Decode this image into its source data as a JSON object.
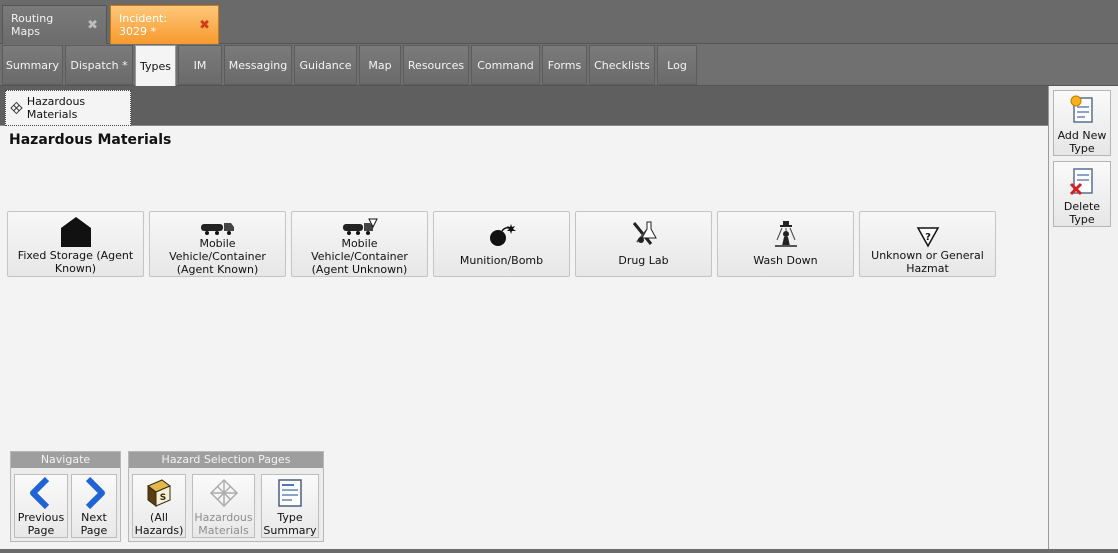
{
  "doc_tabs": [
    {
      "label": "Routing Maps",
      "close": "✖",
      "active": false
    },
    {
      "label": "Incident: 3029 *",
      "close": "✖",
      "active": true
    }
  ],
  "section_tabs": [
    "Summary",
    "Dispatch *",
    "Types",
    "IM",
    "Messaging",
    "Guidance",
    "Map",
    "Resources",
    "Command",
    "Forms",
    "Checklists",
    "Log"
  ],
  "active_section": "Types",
  "subtab": {
    "label": "Hazardous Materials",
    "icon": "hazmat-diamond-icon"
  },
  "page_title": "Hazardous Materials",
  "type_buttons": [
    {
      "label": "Fixed Storage (Agent Known)",
      "icon": "building-icon"
    },
    {
      "label": "Mobile Vehicle/Container (Agent Known)",
      "icon": "truck-icon"
    },
    {
      "label": "Mobile Vehicle/Container (Agent Unknown)",
      "icon": "truck-hazard-icon"
    },
    {
      "label": "Munition/Bomb",
      "icon": "bomb-icon"
    },
    {
      "label": "Drug Lab",
      "icon": "lab-icon"
    },
    {
      "label": "Wash Down",
      "icon": "washdown-icon"
    },
    {
      "label": "Unknown or General Hazmat",
      "icon": "hazard-diamond-icon"
    }
  ],
  "navigate_group": {
    "title": "Navigate",
    "buttons": [
      {
        "label": "Previous Page",
        "icon": "arrow-left-icon"
      },
      {
        "label": "Next Page",
        "icon": "arrow-right-icon"
      }
    ]
  },
  "hazard_group": {
    "title": "Hazard Selection Pages",
    "buttons": [
      {
        "label": "(All Hazards)",
        "icon": "book-icon",
        "enabled": true
      },
      {
        "label": "Hazardous Materials",
        "icon": "hazmat-grid-icon",
        "enabled": false
      },
      {
        "label": "Type Summary",
        "icon": "document-icon",
        "enabled": true
      }
    ]
  },
  "right_actions": [
    {
      "label": "Add New Type",
      "icon": "add-document-icon"
    },
    {
      "label": "Delete Type",
      "icon": "delete-document-icon"
    }
  ],
  "colors": {
    "active_doc_tab": "#f79a2d",
    "chrome_gray": "#6b6b6b",
    "content_bg": "#f3f3f3",
    "nav_arrow_blue": "#1f63d6"
  }
}
